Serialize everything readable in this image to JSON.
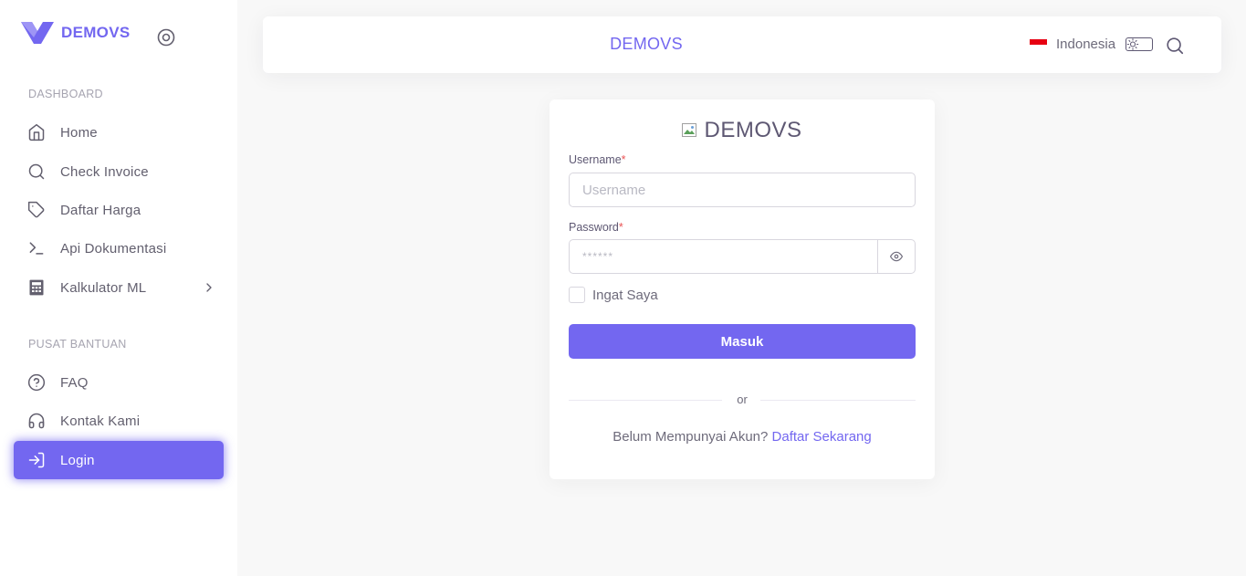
{
  "brand": {
    "name": "DEMOVS"
  },
  "sidebar": {
    "sections": [
      {
        "header": "DASHBOARD"
      },
      {
        "header": "PUSAT BANTUAN"
      }
    ],
    "items": [
      {
        "label": "Home",
        "icon": "home-icon"
      },
      {
        "label": "Check Invoice",
        "icon": "search-icon"
      },
      {
        "label": "Daftar Harga",
        "icon": "tag-icon"
      },
      {
        "label": "Api Dokumentasi",
        "icon": "terminal-icon"
      },
      {
        "label": "Kalkulator ML",
        "icon": "calculator-icon"
      },
      {
        "label": "FAQ",
        "icon": "help-circle-icon"
      },
      {
        "label": "Kontak Kami",
        "icon": "headphones-icon"
      },
      {
        "label": "Login",
        "icon": "log-in-icon",
        "active": true
      }
    ]
  },
  "navbar": {
    "title": "DEMOVS",
    "language": "Indonesia"
  },
  "login": {
    "title": "DEMOVS",
    "username_label": "Username",
    "username_placeholder": "Username",
    "password_label": "Password",
    "password_placeholder": "******",
    "remember_label": "Ingat Saya",
    "submit_label": "Masuk",
    "divider_text": "or",
    "signup_prompt": "Belum Mempunyai Akun?",
    "signup_link": "Daftar Sekarang",
    "required_mark": "*"
  },
  "colors": {
    "primary": "#7367f0",
    "required": "#ea5455",
    "flag_red": "#e70011"
  }
}
